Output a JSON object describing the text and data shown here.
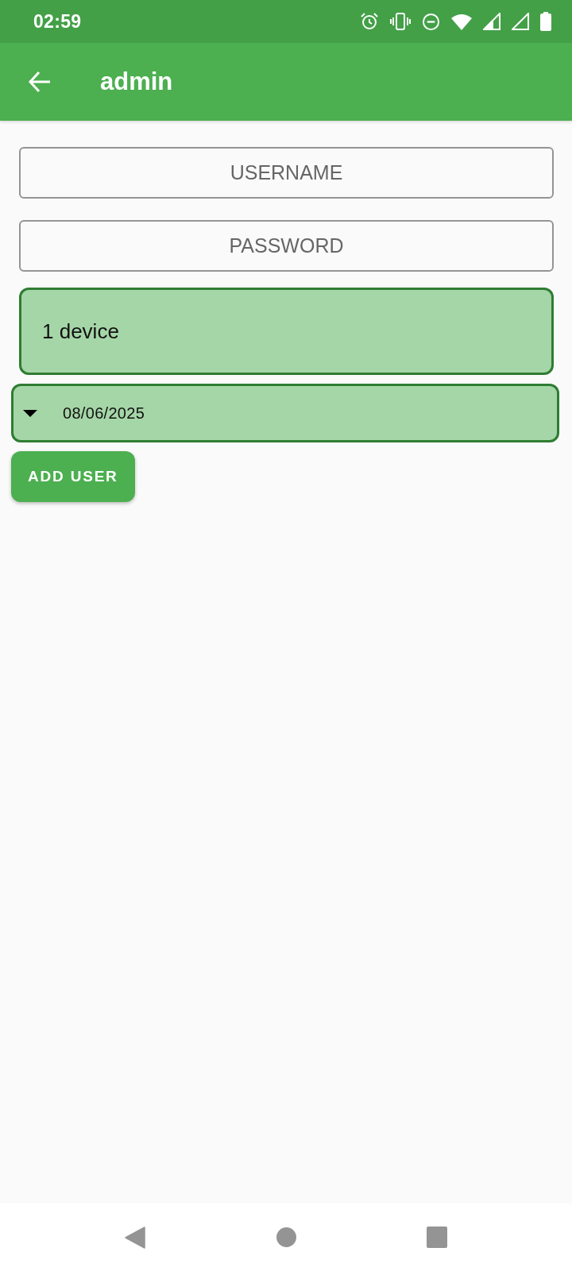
{
  "status_bar": {
    "time": "02:59"
  },
  "app_bar": {
    "title": "admin"
  },
  "form": {
    "username": {
      "placeholder": "USERNAME"
    },
    "password": {
      "placeholder": "PASSWORD"
    },
    "device_count": {
      "value": "1 device"
    },
    "expiry_date": {
      "value": "08/06/2025"
    },
    "submit_button": {
      "label": "ADD USER"
    }
  }
}
